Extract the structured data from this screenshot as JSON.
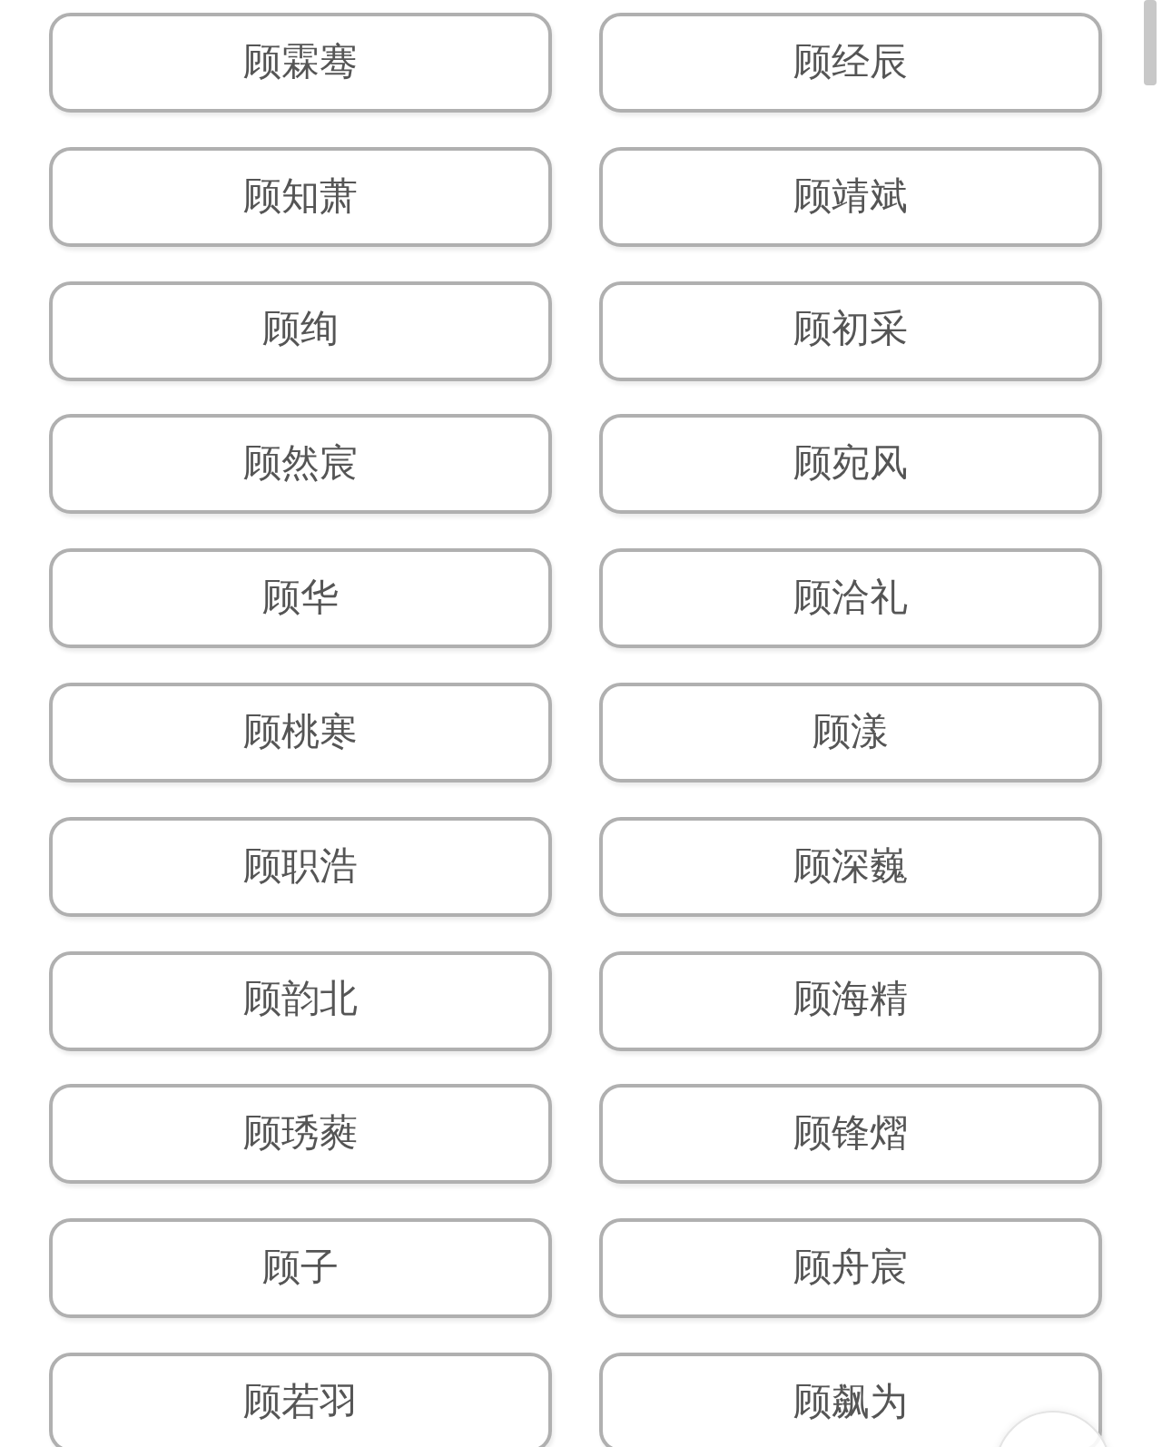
{
  "names": [
    {
      "left": "顾霖骞",
      "right": "顾经辰"
    },
    {
      "left": "顾知萧",
      "right": "顾靖斌"
    },
    {
      "left": "顾绚",
      "right": "顾初采"
    },
    {
      "left": "顾然宸",
      "right": "顾宛风"
    },
    {
      "left": "顾华",
      "right": "顾洽礼"
    },
    {
      "left": "顾桃寒",
      "right": "顾漾"
    },
    {
      "left": "顾职浩",
      "right": "顾深巍"
    },
    {
      "left": "顾韵北",
      "right": "顾海精"
    },
    {
      "left": "顾琇蕤",
      "right": "顾锋熠"
    },
    {
      "left": "顾子",
      "right": "顾舟宸"
    },
    {
      "left": "顾若羽",
      "right": "顾飙为"
    }
  ]
}
